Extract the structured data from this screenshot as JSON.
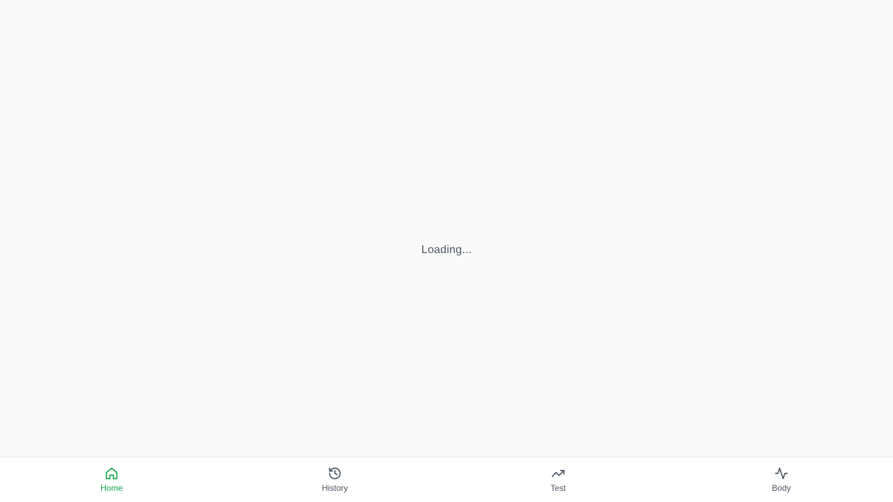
{
  "main": {
    "loading_text": "Loading..."
  },
  "bottom_nav": {
    "active_color": "#16a34a",
    "inactive_color": "#4b5563",
    "items": [
      {
        "label": "Home",
        "icon": "home-icon",
        "active": true
      },
      {
        "label": "History",
        "icon": "history-icon",
        "active": false
      },
      {
        "label": "Test",
        "icon": "trending-up-icon",
        "active": false
      },
      {
        "label": "Body",
        "icon": "activity-icon",
        "active": false
      }
    ]
  }
}
